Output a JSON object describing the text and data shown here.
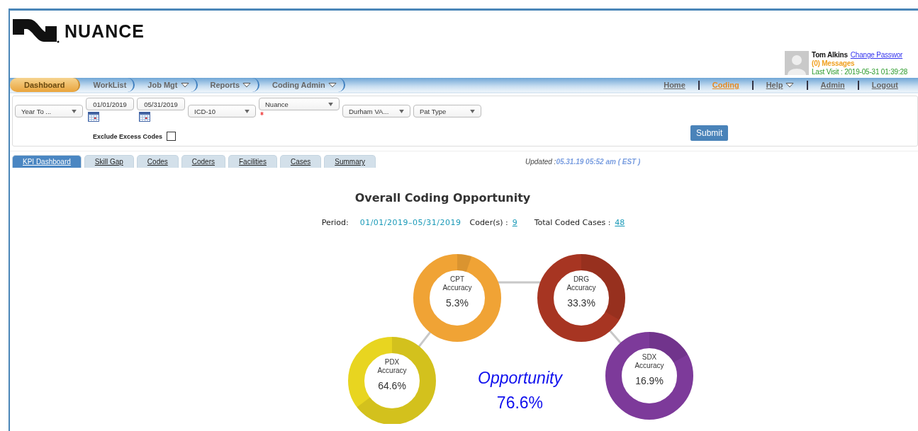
{
  "logo": {
    "text": "NUANCE"
  },
  "user": {
    "name": "Tom Alkins",
    "link": "Change Passwor",
    "messages": "(0) Messages",
    "last_visit": "Last Visit : 2019-05-31 01:39:28"
  },
  "main_nav": [
    {
      "label": "Dashboard",
      "selected": true,
      "dropdown": false
    },
    {
      "label": "WorkList",
      "selected": false,
      "dropdown": false
    },
    {
      "label": "Job Mgt",
      "selected": false,
      "dropdown": true
    },
    {
      "label": "Reports",
      "selected": false,
      "dropdown": true
    },
    {
      "label": "Coding Admin",
      "selected": false,
      "dropdown": true
    }
  ],
  "top_links": [
    {
      "label": "Home",
      "selected": false,
      "dropdown": false
    },
    {
      "label": "Coding",
      "selected": true,
      "dropdown": false
    },
    {
      "label": "Help",
      "selected": false,
      "dropdown": true
    },
    {
      "label": "Admin",
      "selected": false,
      "dropdown": false
    },
    {
      "label": "Logout",
      "selected": false,
      "dropdown": false
    }
  ],
  "filters": {
    "fields": [
      {
        "kind": "select",
        "value": "Year To ...",
        "required": false
      },
      {
        "kind": "date",
        "value": "01/01/2019",
        "required": false
      },
      {
        "kind": "date",
        "value": "05/31/2019",
        "required": false
      },
      {
        "kind": "select",
        "value": "ICD-10",
        "required": false
      },
      {
        "kind": "wide",
        "value": "Nuance",
        "required": true
      },
      {
        "kind": "select",
        "value": "Durham VA...",
        "required": false
      },
      {
        "kind": "select",
        "value": "Pat Type",
        "required": false
      }
    ],
    "exclude": {
      "label": "Exclude Excess Codes",
      "checked": false
    },
    "submit": "Submit"
  },
  "tabs": [
    {
      "label": "KPI Dashboard",
      "selected": true
    },
    {
      "label": "Skill Gap",
      "selected": false
    },
    {
      "label": "Codes",
      "selected": false
    },
    {
      "label": "Coders",
      "selected": false
    },
    {
      "label": "Facilities",
      "selected": false
    },
    {
      "label": "Cases",
      "selected": false
    },
    {
      "label": "Summary",
      "selected": false
    }
  ],
  "updated": {
    "label": "Updated :",
    "value": "05.31.19 05:52 am ( EST )"
  },
  "summary": {
    "title": "Overall Coding Opportunity",
    "period_label": "Period:",
    "period": "01/01/2019–05/31/2019",
    "coders_label": "Coder(s) :",
    "coders": "9",
    "cases_label": "Total Coded Cases :",
    "cases": "48"
  },
  "donuts": [
    {
      "name": "CPT",
      "label": "Accuracy",
      "value": "5.3%",
      "level": 0.053,
      "color": "#f0a335"
    },
    {
      "name": "DRG",
      "label": "Accuracy",
      "value": "33.3%",
      "level": 0.333,
      "color": "#a73522"
    },
    {
      "name": "PDX",
      "label": "Accuracy",
      "value": "64.6%",
      "level": 0.646,
      "color": "#e8d520"
    },
    {
      "name": "SDX",
      "label": "Accuracy",
      "value": "16.9%",
      "level": 0.169,
      "color": "#7d3a9a"
    }
  ],
  "opportunity": {
    "label": "Opportunity",
    "value": "76.6%"
  }
}
